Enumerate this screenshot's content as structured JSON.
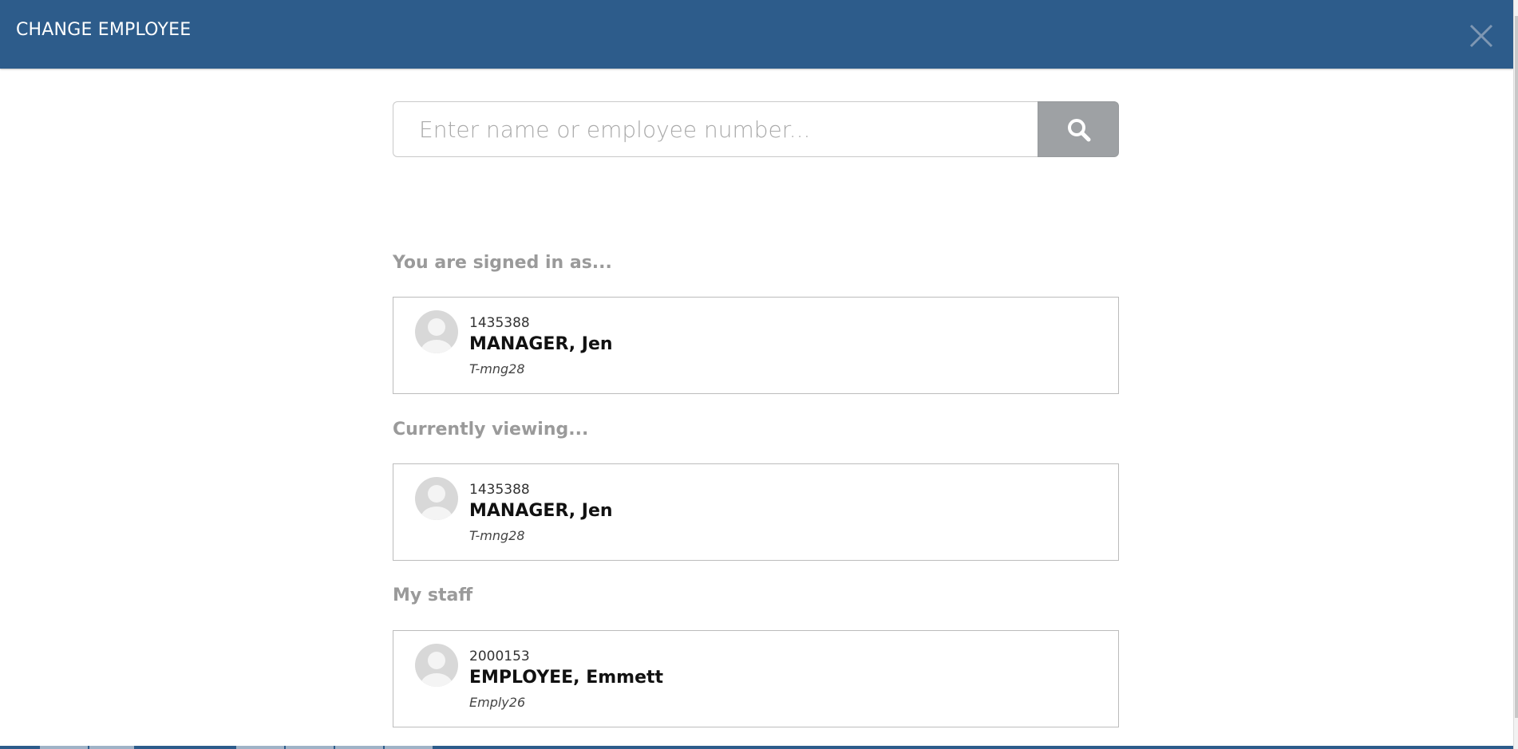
{
  "header": {
    "title": "CHANGE EMPLOYEE",
    "close_icon": "close-icon"
  },
  "search": {
    "placeholder": "Enter name or employee number...",
    "value": "",
    "button_icon": "search-icon"
  },
  "sections": {
    "signed_in": {
      "label": "You are signed in as...",
      "employee": {
        "number": "1435388",
        "name": "MANAGER, Jen",
        "code": "T-mng28"
      }
    },
    "viewing": {
      "label": "Currently viewing...",
      "employee": {
        "number": "1435388",
        "name": "MANAGER, Jen",
        "code": "T-mng28"
      }
    },
    "staff": {
      "label": "My staff",
      "employees": [
        {
          "number": "2000153",
          "name": "EMPLOYEE, Emmett",
          "code": "Emply26"
        }
      ]
    }
  },
  "colors": {
    "header_bg": "#2d5c8b",
    "search_button": "#9ea1a4",
    "section_label": "#9a9a9a"
  }
}
